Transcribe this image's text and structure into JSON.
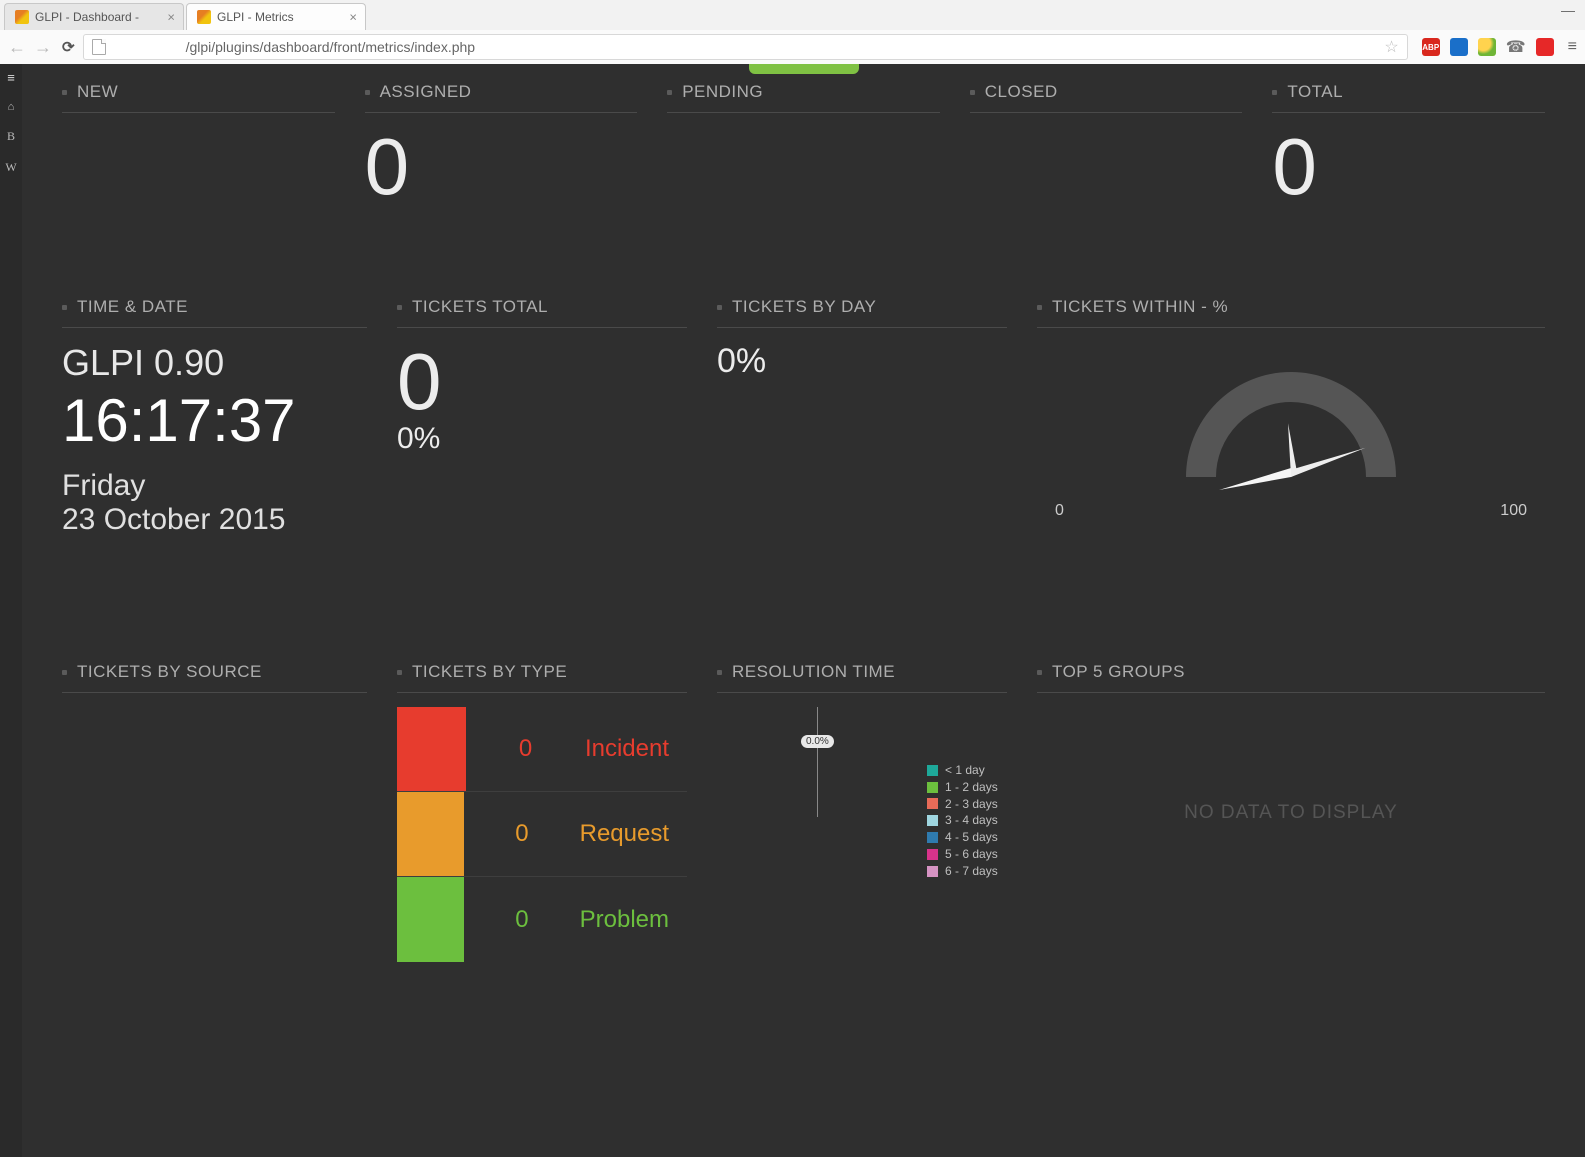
{
  "browser": {
    "tabs": [
      {
        "title": "GLPI - Dashboard - ",
        "active": false
      },
      {
        "title": "GLPI - Metrics",
        "active": true
      }
    ],
    "url": "/glpi/plugins/dashboard/front/metrics/index.php",
    "ext_abp": "ABP"
  },
  "sidebar": {
    "b": "B",
    "w": "W"
  },
  "status_cards": {
    "new": {
      "label": "NEW",
      "value": ""
    },
    "assigned": {
      "label": "ASSIGNED",
      "value": "0"
    },
    "pending": {
      "label": "PENDING",
      "value": ""
    },
    "closed": {
      "label": "CLOSED",
      "value": ""
    },
    "total": {
      "label": "TOTAL",
      "value": "0"
    }
  },
  "time_date": {
    "label": "TIME & DATE",
    "title": "GLPI 0.90",
    "clock": "16:17:37",
    "day": "Friday",
    "date": "23 October 2015"
  },
  "tickets_total": {
    "label": "TICKETS TOTAL",
    "value": "0",
    "pct": "0%"
  },
  "tickets_by_day": {
    "label": "TICKETS BY DAY",
    "pct": "0%"
  },
  "tickets_within": {
    "label": "TICKETS WITHIN - %",
    "min": "0",
    "max": "100",
    "value": 0
  },
  "tickets_by_source": {
    "label": "TICKETS BY SOURCE"
  },
  "tickets_by_type": {
    "label": "TICKETS BY TYPE",
    "items": [
      {
        "name": "Incident",
        "count": "0",
        "color": "#e73c2e"
      },
      {
        "name": "Request",
        "count": "0",
        "color": "#e89b2c"
      },
      {
        "name": "Problem",
        "count": "0",
        "color": "#6cbf3e"
      }
    ]
  },
  "resolution_time": {
    "label": "RESOLUTION TIME",
    "badge": "0.0%",
    "legend": [
      {
        "name": "< 1 day",
        "color": "#1ea99a"
      },
      {
        "name": "1 - 2 days",
        "color": "#6cbf3e"
      },
      {
        "name": "2 - 3 days",
        "color": "#e86b58"
      },
      {
        "name": "3 - 4 days",
        "color": "#9fd6e0"
      },
      {
        "name": "4 - 5 days",
        "color": "#2f7baf"
      },
      {
        "name": "5 - 6 days",
        "color": "#d9338b"
      },
      {
        "name": "6 - 7 days",
        "color": "#d693c3"
      }
    ]
  },
  "top_groups": {
    "label": "TOP 5 GROUPS",
    "no_data": "no data to display"
  },
  "chart_data": {
    "gauge": {
      "type": "gauge",
      "title": "TICKETS WITHIN - %",
      "min": 0,
      "max": 100,
      "value": 0
    },
    "tickets_by_type": {
      "type": "bar",
      "title": "TICKETS BY TYPE",
      "categories": [
        "Incident",
        "Request",
        "Problem"
      ],
      "values": [
        0,
        0,
        0
      ],
      "colors": [
        "#e73c2e",
        "#e89b2c",
        "#6cbf3e"
      ]
    },
    "resolution_time": {
      "type": "bar",
      "title": "RESOLUTION TIME",
      "categories": [
        "< 1 day",
        "1 - 2 days",
        "2 - 3 days",
        "3 - 4 days",
        "4 - 5 days",
        "5 - 6 days",
        "6 - 7 days"
      ],
      "values": [
        0,
        0,
        0,
        0,
        0,
        0,
        0
      ],
      "ylabel": "%",
      "ylim": [
        0,
        100
      ]
    }
  }
}
